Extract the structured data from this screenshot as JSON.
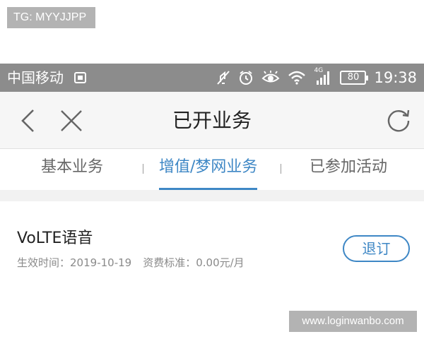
{
  "watermarks": {
    "top": "TG: MYYJJPP",
    "bottom": "www.loginwanbo.com"
  },
  "status_bar": {
    "carrier": "中国移动",
    "network": "4G",
    "battery": "80",
    "time": "19:38",
    "icons": [
      "image-notification-icon",
      "mute-icon",
      "alarm-icon",
      "eye-icon",
      "wifi-icon",
      "signal-icon",
      "battery-icon"
    ]
  },
  "header": {
    "title": "已开业务",
    "icons": [
      "back-icon",
      "close-icon",
      "refresh-icon"
    ]
  },
  "tabs": [
    {
      "label": "基本业务",
      "active": false
    },
    {
      "label": "增值/梦网业务",
      "active": true
    },
    {
      "label": "已参加活动",
      "active": false
    }
  ],
  "services": [
    {
      "name": "VoLTE语音",
      "effective_time_label": "生效时间：",
      "effective_time": "2019-10-19",
      "fee_label": "资费标准：",
      "fee": "0.00元/月",
      "action_label": "退订"
    }
  ],
  "colors": {
    "accent": "#3e87c5",
    "status_bar": "#8c8c8c",
    "nav_bg": "#f6f6f6"
  }
}
